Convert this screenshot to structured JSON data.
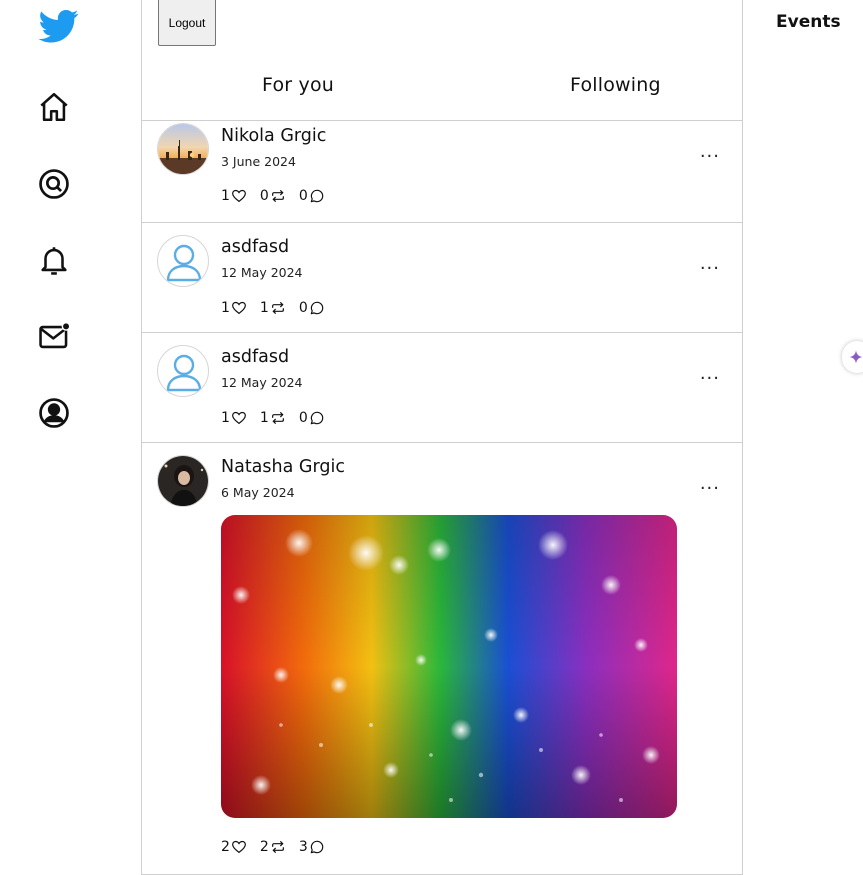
{
  "header": {
    "logout_label": "Logout"
  },
  "tabs": [
    {
      "label": "For you"
    },
    {
      "label": "Following"
    }
  ],
  "posts": [
    {
      "author": "Nikola Grgic",
      "date": "3 June 2024",
      "likes": "1",
      "retweets": "0",
      "comments": "0",
      "avatar": "city-sunset-photo"
    },
    {
      "author": "asdfasd",
      "date": "12 May 2024",
      "likes": "1",
      "retweets": "1",
      "comments": "0",
      "avatar": "default-user-icon"
    },
    {
      "author": "asdfasd",
      "date": "12 May 2024",
      "likes": "1",
      "retweets": "1",
      "comments": "0",
      "avatar": "default-user-icon"
    },
    {
      "author": "Natasha Grgic",
      "date": "6 May 2024",
      "likes": "2",
      "retweets": "2",
      "comments": "3",
      "avatar": "person-photo",
      "image": "rainbow-glitter-photo"
    }
  ],
  "more_label": "...",
  "right": {
    "events_title": "Events"
  },
  "colors": {
    "brand": "#1D9BF0",
    "divider": "#cfcfcf",
    "default_avatar": "#5aaee6"
  },
  "icons": [
    "twitter-bird-icon",
    "home-icon",
    "explore-icon",
    "bell-icon",
    "mail-icon",
    "profile-icon",
    "heart-icon",
    "retweet-icon",
    "comment-icon",
    "sparkle-icon"
  ]
}
